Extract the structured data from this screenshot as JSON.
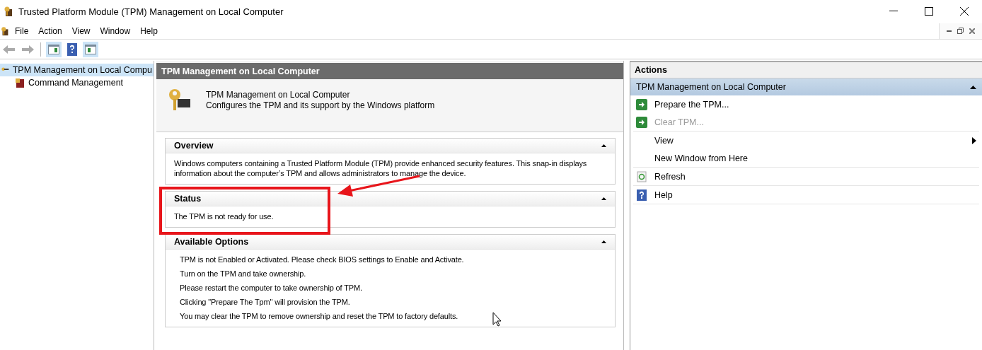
{
  "window": {
    "title": "Trusted Platform Module (TPM) Management on Local Computer"
  },
  "menu": [
    "File",
    "Action",
    "View",
    "Window",
    "Help"
  ],
  "tree": [
    {
      "label": "TPM Management on Local Compu",
      "selected": true,
      "children": [
        {
          "label": "Command Management",
          "selected": false
        }
      ]
    }
  ],
  "center": {
    "header": "TPM Management on Local Computer",
    "intro_title": "TPM Management on Local Computer",
    "intro_text": "Configures the TPM and its support by the Windows platform",
    "sections": [
      {
        "title": "Overview",
        "expanded": true,
        "lines": [
          "Windows computers containing a Trusted Platform Module (TPM) provide enhanced security features. This snap-in displays information about the computer’s TPM and allows administrators to manage the device."
        ]
      },
      {
        "title": "Status",
        "expanded": true,
        "lines": [
          "The TPM is not ready for use."
        ]
      },
      {
        "title": "Available Options",
        "expanded": true,
        "lines": [
          "TPM is not Enabled or Activated. Please check BIOS settings to Enable and Activate.",
          "Turn on the TPM and take ownership.",
          "Please restart the computer to take ownership of TPM.",
          "Clicking \"Prepare The Tpm\" will provision the TPM.",
          "You may clear the TPM to remove ownership and reset the TPM to factory defaults."
        ]
      }
    ]
  },
  "actions": {
    "title": "Actions",
    "group_title": "TPM Management on Local Computer",
    "groups": [
      [
        {
          "label": "Prepare the TPM...",
          "kind": "run",
          "disabled": false
        },
        {
          "label": "Clear TPM...",
          "kind": "run",
          "disabled": true
        }
      ],
      [
        {
          "label": "View",
          "kind": "submenu",
          "disabled": false
        },
        {
          "label": "New Window from Here",
          "kind": "plain",
          "disabled": false
        }
      ],
      [
        {
          "label": "Refresh",
          "kind": "refresh",
          "disabled": false
        }
      ],
      [
        {
          "label": "Help",
          "kind": "help",
          "disabled": false
        }
      ]
    ]
  }
}
